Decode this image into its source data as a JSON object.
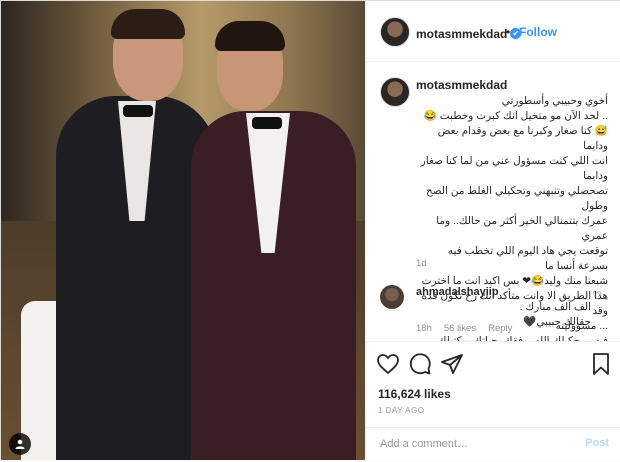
{
  "header": {
    "username": "motasmmekdad",
    "verified_mark": "✔",
    "separator": "•",
    "follow_label": "Follow"
  },
  "caption": {
    "username": "motasmmekdad",
    "text": "أخوي وحبيبي وأسطورتي\n.. لحد الآن مو متخيل انك كبرت وخطبت 😂\n😅 كنا صغار وكبرنا مع بعض وقدام بعض ودايما\nانت اللي كنت مسؤول عني من لما كنا صغار ودايما\nتصحصلي وتنبهني وتحكيلي الغلط من الصح وطول\nعمرك بتتمنالي الخير أكثر من حالك.. وما عمري\nتوقعت يجي هاد اليوم اللي تخطب فيه بسرعة أنسا ما\nشبعنا منك وليد😂❤ بس اكيد انت ما اخترت\nهذا الطريق الا وانت متأكد أنك رح تكون قده وقد\n... مسؤوليته\nفيس بحكيلك الله يوفقك بحياتك ويكتبلك الخير وين ما\n@waleedmiqdad 🖤🖤🖤كان يا حبيب قلبي",
    "age": "1d"
  },
  "comment": {
    "username": "ahmadalshayiip",
    "text": "الف الف مبارك .\nحقالك حبيبي🖤",
    "age": "18h",
    "likes": "56 likes",
    "reply_label": "Reply"
  },
  "post": {
    "likes": "116,624 likes",
    "posted_ago": "1 DAY AGO"
  },
  "add_comment": {
    "placeholder": "Add a comment…",
    "post_label": "Post"
  },
  "colors": {
    "accent": "#3897f0",
    "muted": "#8e8e8e",
    "post_disabled": "#b3dbff"
  }
}
